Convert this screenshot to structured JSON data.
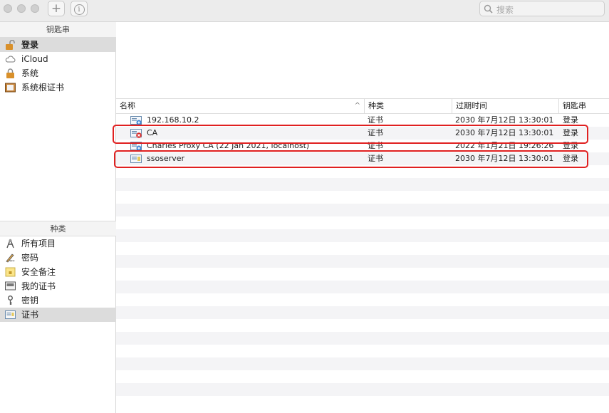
{
  "toolbar": {
    "add_symbol": "+",
    "info_symbol": "i",
    "search_placeholder": "搜索"
  },
  "sidebar": {
    "keychains_header": "钥匙串",
    "keychains": [
      {
        "label": "登录",
        "icon": "unlocked-padlock-icon",
        "selected": true
      },
      {
        "label": "iCloud",
        "icon": "cloud-icon",
        "selected": false
      },
      {
        "label": "系统",
        "icon": "padlock-icon",
        "selected": false
      },
      {
        "label": "系统根证书",
        "icon": "cabinet-icon",
        "selected": false
      }
    ],
    "categories_header": "种类",
    "categories": [
      {
        "label": "所有项目",
        "icon": "all-items-icon",
        "selected": false
      },
      {
        "label": "密码",
        "icon": "password-pen-icon",
        "selected": false
      },
      {
        "label": "安全备注",
        "icon": "secure-note-icon",
        "selected": false
      },
      {
        "label": "我的证书",
        "icon": "my-certificate-icon",
        "selected": false
      },
      {
        "label": "密钥",
        "icon": "key-icon",
        "selected": false
      },
      {
        "label": "证书",
        "icon": "certificate-icon",
        "selected": true
      }
    ]
  },
  "table": {
    "columns": [
      "名称",
      "种类",
      "过期时间",
      "钥匙串"
    ],
    "sort_indicator": "^",
    "rows": [
      {
        "name": "192.168.10.2",
        "kind": "证书",
        "expires": "2030 年7月12日 13:30:01",
        "keychain": "登录",
        "icon": "certificate-blue-icon"
      },
      {
        "name": "CA",
        "kind": "证书",
        "expires": "2030 年7月12日 13:30:01",
        "keychain": "登录",
        "icon": "certificate-untrusted-icon"
      },
      {
        "name": "Charles Proxy CA (22 Jan 2021, localhost)",
        "kind": "证书",
        "expires": "2022 年1月21日 19:26:26",
        "keychain": "登录",
        "icon": "certificate-blue-icon"
      },
      {
        "name": "ssoserver",
        "kind": "证书",
        "expires": "2030 年7月12日 13:30:01",
        "keychain": "登录",
        "icon": "certificate-icon"
      }
    ]
  },
  "colors": {
    "highlight_border": "#e02020",
    "selection_bg": "#dcdcdc"
  }
}
